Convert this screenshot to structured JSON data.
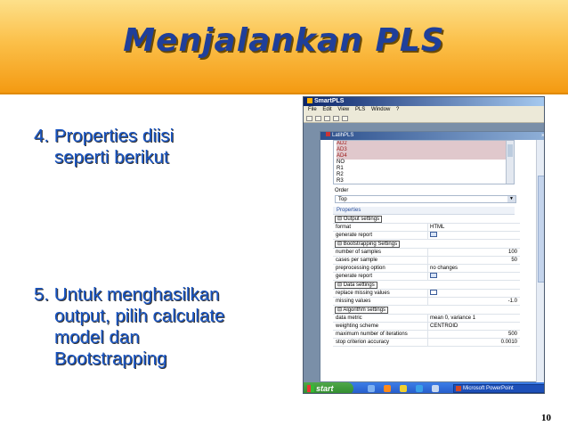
{
  "slide": {
    "title": "Menjalankan PLS",
    "bullet4_line1": "4. Properties diisi",
    "bullet4_line2": "seperti berikut",
    "bullet5_line1": "5. Untuk menghasilkan",
    "bullet5_line2": "output, pilih calculate",
    "bullet5_line3": "model dan",
    "bullet5_line4": "Bootstrapping",
    "page_number": "10"
  },
  "screenshot": {
    "app_title": "SmartPLS",
    "menu": [
      "File",
      "Edit",
      "View",
      "PLS",
      "Window",
      "?"
    ],
    "inner_title": "LatihPLS",
    "list_items": [
      "AD2",
      "AD3",
      "AD4",
      "NO",
      "R1",
      "R2",
      "R3"
    ],
    "order_label": "Order",
    "order_value": "Top",
    "properties_tab": "Properties",
    "output_settings": "Output settings",
    "format_label": "format",
    "format_value": "HTML",
    "generate_report_label": "generate report",
    "bootstrapping_settings": "Bootstrapping Settings",
    "number_of_samples_label": "number of samples",
    "number_of_samples_value": "100",
    "cases_per_sample_label": "cases per sample",
    "cases_per_sample_value": "50",
    "preprocessing_label": "preprocessing option",
    "preprocessing_value": "no changes",
    "generate_report2_label": "generate report",
    "data_settings": "Data settings",
    "replace_missing_label": "replace missing values",
    "missing_values_label": "missing values",
    "missing_values_value": "-1.0",
    "algorithm_settings": "Algorithm settings",
    "data_metric_label": "data metric",
    "data_metric_value": "mean 0, variance 1",
    "weighting_scheme_label": "weighting scheme",
    "weighting_scheme_value": "CENTROID",
    "max_iterations_label": "maximum number of iterations",
    "max_iterations_value": "500",
    "stop_criterion_label": "stop criterion accuracy",
    "stop_criterion_value": "0.0010",
    "start_label": "start",
    "taskbar_item": "Microsoft PowerPoint"
  },
  "colors": {
    "title_text": "#1f3f9a",
    "bullet_text": "#1a56c4",
    "band_top": "#fde08a",
    "band_bottom": "#f49a12"
  }
}
